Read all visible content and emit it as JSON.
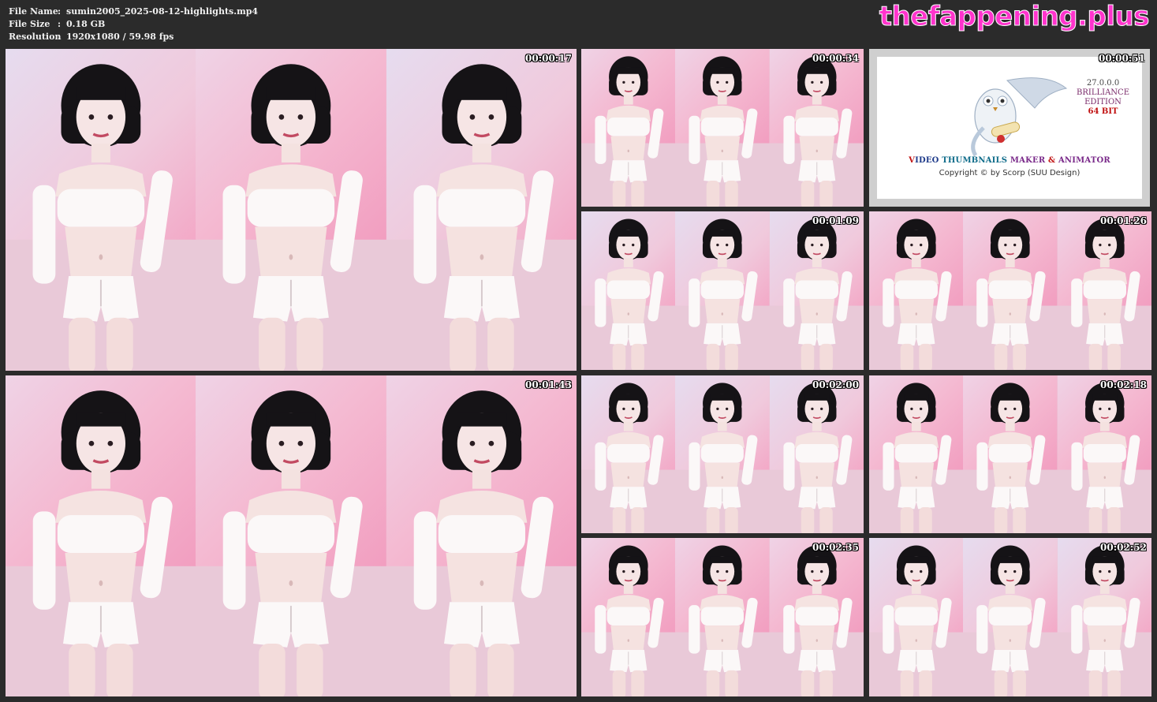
{
  "meta": {
    "rows": [
      {
        "key": "File Name",
        "sep": ":",
        "value": "sumin2005_2025-08-12-highlights.mp4"
      },
      {
        "key": "File Size",
        "sep": ":",
        "value": "0.18 GB"
      },
      {
        "key": "Resolution",
        "sep": ":",
        "value": "1920x1080 / 59.98 fps"
      }
    ]
  },
  "watermark": "thefappening.plus",
  "thumbnails": [
    {
      "timestamp": "00:00:17"
    },
    {
      "timestamp": "00:00:34"
    },
    {
      "timestamp": "00:00:51"
    },
    {
      "timestamp": "00:01:09"
    },
    {
      "timestamp": "00:01:26"
    },
    {
      "timestamp": "00:01:43"
    },
    {
      "timestamp": "00:02:00"
    },
    {
      "timestamp": "00:02:18"
    },
    {
      "timestamp": "00:02:35"
    },
    {
      "timestamp": "00:02:52"
    }
  ],
  "vtm_card": {
    "version": "27.0.0.0",
    "edition_1": "BRILLIANCE",
    "edition_2": "EDITION",
    "bit": "64 BIT",
    "title_v": "V",
    "title_ideo": "IDEO ",
    "title_thumb": "THUMBNAILS ",
    "title_maker": "MAKER ",
    "title_amp": "& ",
    "title_anim": "ANIMATOR",
    "copyright": "Copyright © by Scorp (SUU Design)"
  },
  "colors": {
    "background": "#2b2b2b",
    "watermark": "#ff33cc",
    "pink_bg": "#f2b8cf",
    "lavender_bg": "#e3d3ea"
  }
}
